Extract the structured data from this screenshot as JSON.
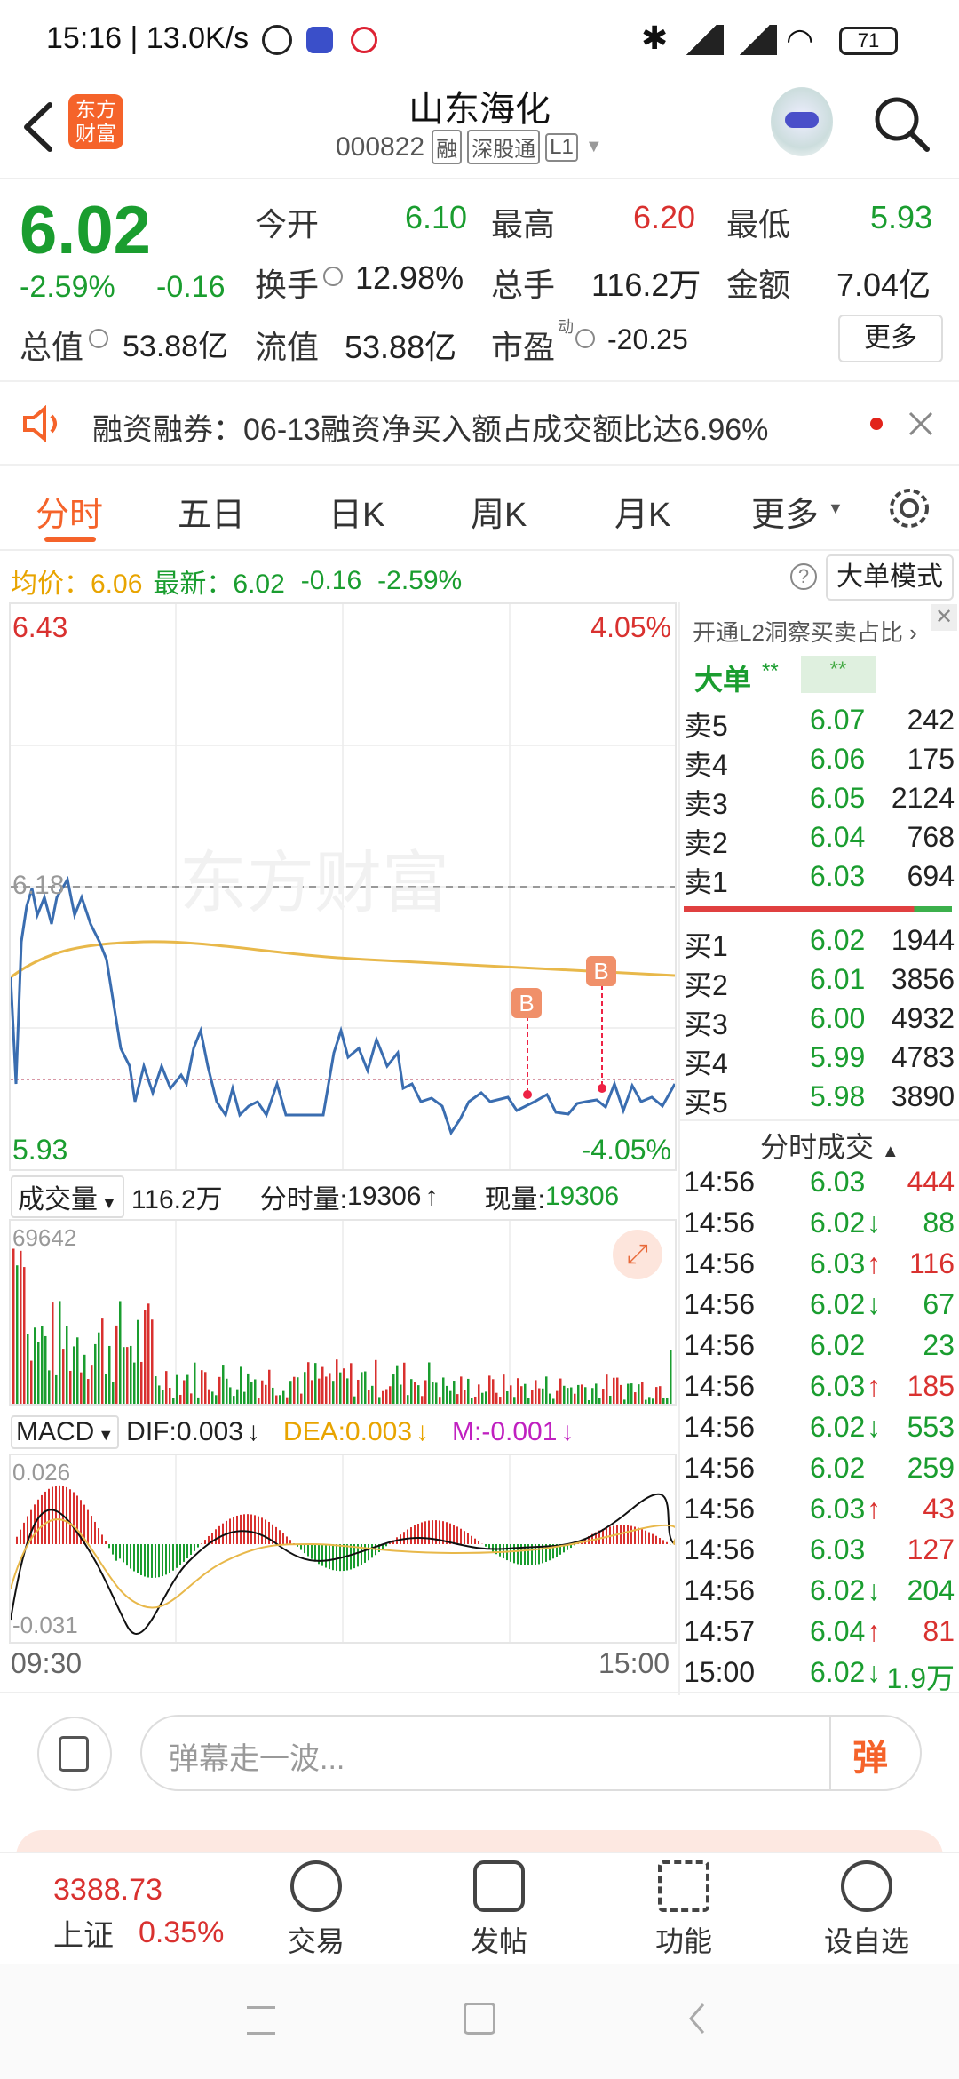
{
  "status_bar": {
    "time_speed": "15:16 | 13.0K/s",
    "battery": "71"
  },
  "header": {
    "logo_text": "东方财富",
    "title": "山东海化",
    "code": "000822",
    "badges": [
      "融",
      "深股通",
      "L1"
    ]
  },
  "quote": {
    "price": "6.02",
    "change_pct": "-2.59%",
    "change": "-0.16",
    "stats": [
      {
        "label": "今开",
        "value": "6.10",
        "color": "green"
      },
      {
        "label": "最高",
        "value": "6.20",
        "color": "red"
      },
      {
        "label": "最低",
        "value": "5.93",
        "color": "green"
      },
      {
        "label": "换手",
        "value": "12.98%",
        "color": "black"
      },
      {
        "label": "总手",
        "value": "116.2万",
        "color": "black"
      },
      {
        "label": "金额",
        "value": "7.04亿",
        "color": "black"
      },
      {
        "label": "总值",
        "value": "53.88亿",
        "color": "black"
      },
      {
        "label": "流值",
        "value": "53.88亿",
        "color": "black"
      },
      {
        "label": "市盈",
        "value": "-20.25",
        "color": "black"
      }
    ],
    "pe_sup": "动",
    "more_label": "更多"
  },
  "notice": {
    "text": "融资融券：06-13融资净买入额占成交额比达6.96%"
  },
  "tabs": [
    "分时",
    "五日",
    "日K",
    "周K",
    "月K",
    "更多"
  ],
  "info_line": {
    "avg_label": "均价：6.06",
    "latest_label": "最新：6.02",
    "chg": "-0.16",
    "pct": "-2.59%",
    "big_order_mode": "大单模式"
  },
  "intraday": {
    "y_max": "6.43",
    "y_min": "5.93",
    "pct_max": "4.05%",
    "pct_min": "-4.05%",
    "ref_price": "6.18",
    "watermark": "东方财富",
    "marker": "B"
  },
  "volume": {
    "menu": "成交量",
    "total": "116.2万",
    "fenshi_label": "分时量:",
    "fenshi_val": "19306",
    "now_label": "现量:",
    "now_val": "19306",
    "max_label": "69642"
  },
  "macd": {
    "menu": "MACD",
    "dif": "DIF:0.003",
    "dea": "DEA:0.003",
    "m": "M:-0.001",
    "top": "0.026",
    "bottom": "-0.031"
  },
  "time_axis": {
    "start": "09:30",
    "end": "15:00"
  },
  "order_book": {
    "promo": "开通L2洞察买卖占比",
    "big_label": "大单",
    "big_v1": "**",
    "big_v2": "**",
    "asks": [
      {
        "label": "卖5",
        "price": "6.07",
        "vol": "242"
      },
      {
        "label": "卖4",
        "price": "6.06",
        "vol": "175"
      },
      {
        "label": "卖3",
        "price": "6.05",
        "vol": "2124"
      },
      {
        "label": "卖2",
        "price": "6.04",
        "vol": "768"
      },
      {
        "label": "卖1",
        "price": "6.03",
        "vol": "694"
      }
    ],
    "bids": [
      {
        "label": "买1",
        "price": "6.02",
        "vol": "1944"
      },
      {
        "label": "买2",
        "price": "6.01",
        "vol": "3856"
      },
      {
        "label": "买3",
        "price": "6.00",
        "vol": "4932"
      },
      {
        "label": "买4",
        "price": "5.99",
        "vol": "4783"
      },
      {
        "label": "买5",
        "price": "5.98",
        "vol": "3890"
      }
    ]
  },
  "trades": {
    "title": "分时成交",
    "rows": [
      {
        "time": "14:56",
        "price": "6.03",
        "arrow": "",
        "vol": "444",
        "color": "red"
      },
      {
        "time": "14:56",
        "price": "6.02",
        "arrow": "↓",
        "vol": "88",
        "color": "green"
      },
      {
        "time": "14:56",
        "price": "6.03",
        "arrow": "↑",
        "vol": "116",
        "color": "red"
      },
      {
        "time": "14:56",
        "price": "6.02",
        "arrow": "↓",
        "vol": "67",
        "color": "green"
      },
      {
        "time": "14:56",
        "price": "6.02",
        "arrow": "",
        "vol": "23",
        "color": "green"
      },
      {
        "time": "14:56",
        "price": "6.03",
        "arrow": "↑",
        "vol": "185",
        "color": "red"
      },
      {
        "time": "14:56",
        "price": "6.02",
        "arrow": "↓",
        "vol": "553",
        "color": "green"
      },
      {
        "time": "14:56",
        "price": "6.02",
        "arrow": "",
        "vol": "259",
        "color": "green"
      },
      {
        "time": "14:56",
        "price": "6.03",
        "arrow": "↑",
        "vol": "43",
        "color": "red"
      },
      {
        "time": "14:56",
        "price": "6.03",
        "arrow": "",
        "vol": "127",
        "color": "red"
      },
      {
        "time": "14:56",
        "price": "6.02",
        "arrow": "↓",
        "vol": "204",
        "color": "green"
      },
      {
        "time": "14:57",
        "price": "6.04",
        "arrow": "↑",
        "vol": "81",
        "color": "red"
      },
      {
        "time": "15:00",
        "price": "6.02",
        "arrow": "↓",
        "vol": "1.9万",
        "color": "green"
      }
    ]
  },
  "comment": {
    "placeholder": "弹幕走一波...",
    "send": "弹"
  },
  "bottom_nav": {
    "index_value": "3388.73",
    "index_name": "上证",
    "index_pct": "0.35%",
    "items": [
      "交易",
      "发帖",
      "功能",
      "设自选"
    ]
  },
  "colors": {
    "up": "#d9312f",
    "down": "#1a9d2f",
    "brand": "#f5632a",
    "avg_line": "#e8b84a",
    "price_line": "#3a6db0"
  }
}
